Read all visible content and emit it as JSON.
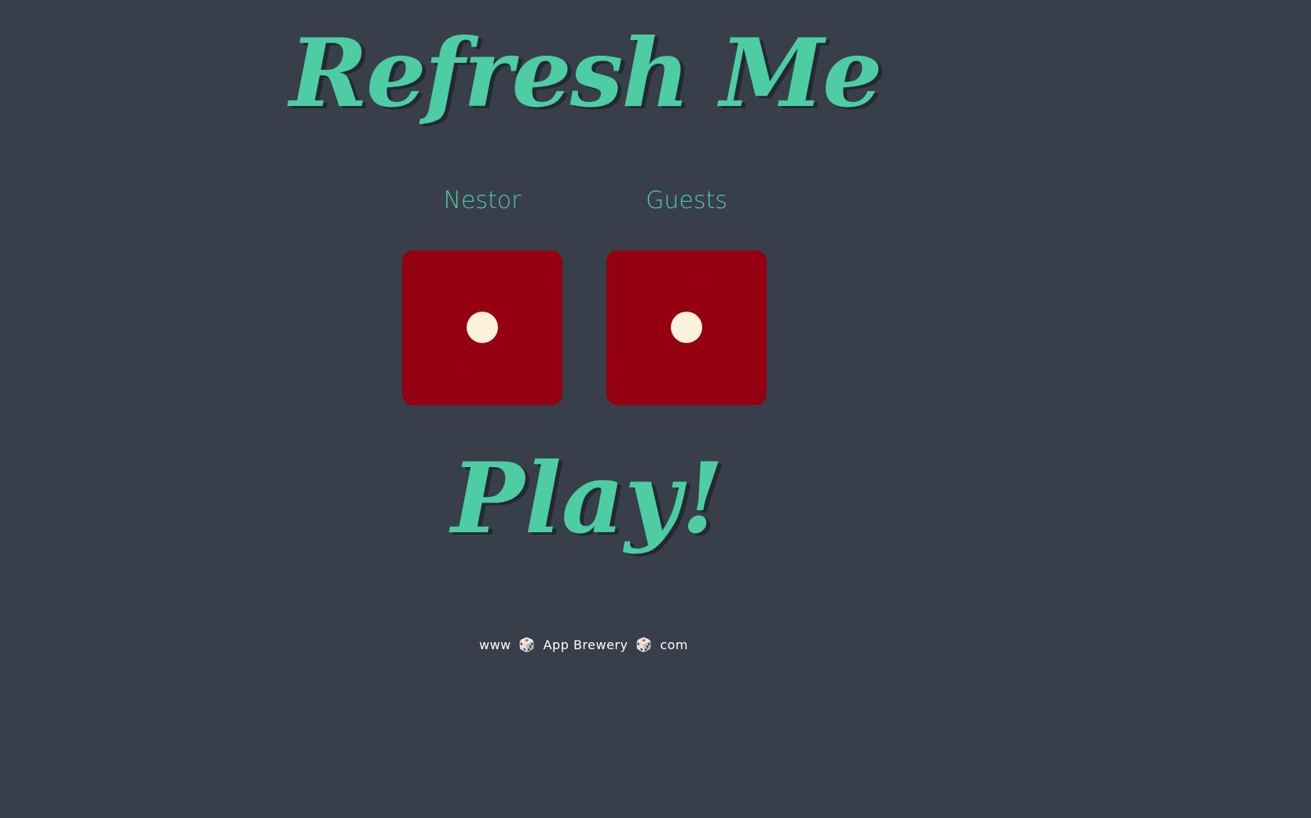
{
  "header": {
    "title": "Refresh Me"
  },
  "players": [
    {
      "name": "Nestor",
      "die_value": 1
    },
    {
      "name": "Guests",
      "die_value": 1
    }
  ],
  "colors": {
    "background": "#393f4a",
    "accent": "#4ecca3",
    "die": "#950010",
    "pip": "#fbf1dc"
  },
  "action": {
    "play_label": "Play!"
  },
  "footer": {
    "part1": "www",
    "part2": "App Brewery",
    "part3": "com",
    "separator_icon": "dice-icon",
    "separator_glyph": "🎲"
  }
}
